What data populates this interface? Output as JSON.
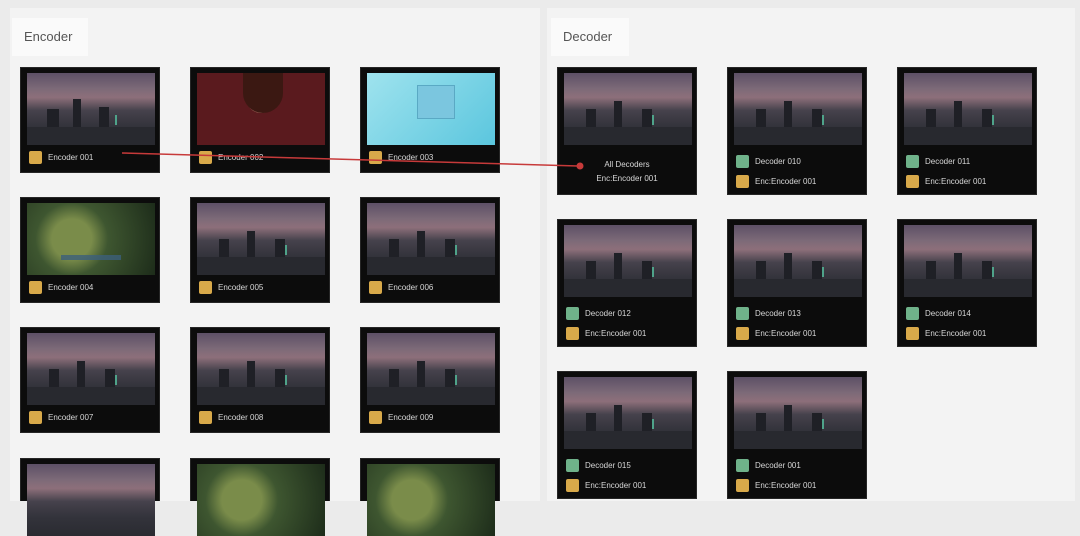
{
  "encoder_tab": "Encoder",
  "decoder_tab": "Decoder",
  "colors": {
    "link": "#c73a3a",
    "chip_yellow": "#d8a94a",
    "chip_green": "#6fb28a"
  },
  "encoders": [
    {
      "label": "Encoder 001",
      "thumb": "city"
    },
    {
      "label": "Encoder 002",
      "thumb": "red"
    },
    {
      "label": "Encoder 003",
      "thumb": "cyan"
    },
    {
      "label": "Encoder 004",
      "thumb": "green"
    },
    {
      "label": "Encoder 005",
      "thumb": "city"
    },
    {
      "label": "Encoder 006",
      "thumb": "city"
    },
    {
      "label": "Encoder 007",
      "thumb": "city"
    },
    {
      "label": "Encoder 008",
      "thumb": "city"
    },
    {
      "label": "Encoder 009",
      "thumb": "city"
    }
  ],
  "decoders": [
    {
      "line1": "All Decoders",
      "line2": "Enc:Encoder 001"
    },
    {
      "line1": "Decoder 010",
      "line2": "Enc:Encoder 001"
    },
    {
      "line1": "Decoder 011",
      "line2": "Enc:Encoder 001"
    },
    {
      "line1": "Decoder 012",
      "line2": "Enc:Encoder 001"
    },
    {
      "line1": "Decoder 013",
      "line2": "Enc:Encoder 001"
    },
    {
      "line1": "Decoder 014",
      "line2": "Enc:Encoder 001"
    },
    {
      "line1": "Decoder 015",
      "line2": "Enc:Encoder 001"
    },
    {
      "line1": "Decoder 001",
      "line2": "Enc:Encoder 001"
    }
  ]
}
